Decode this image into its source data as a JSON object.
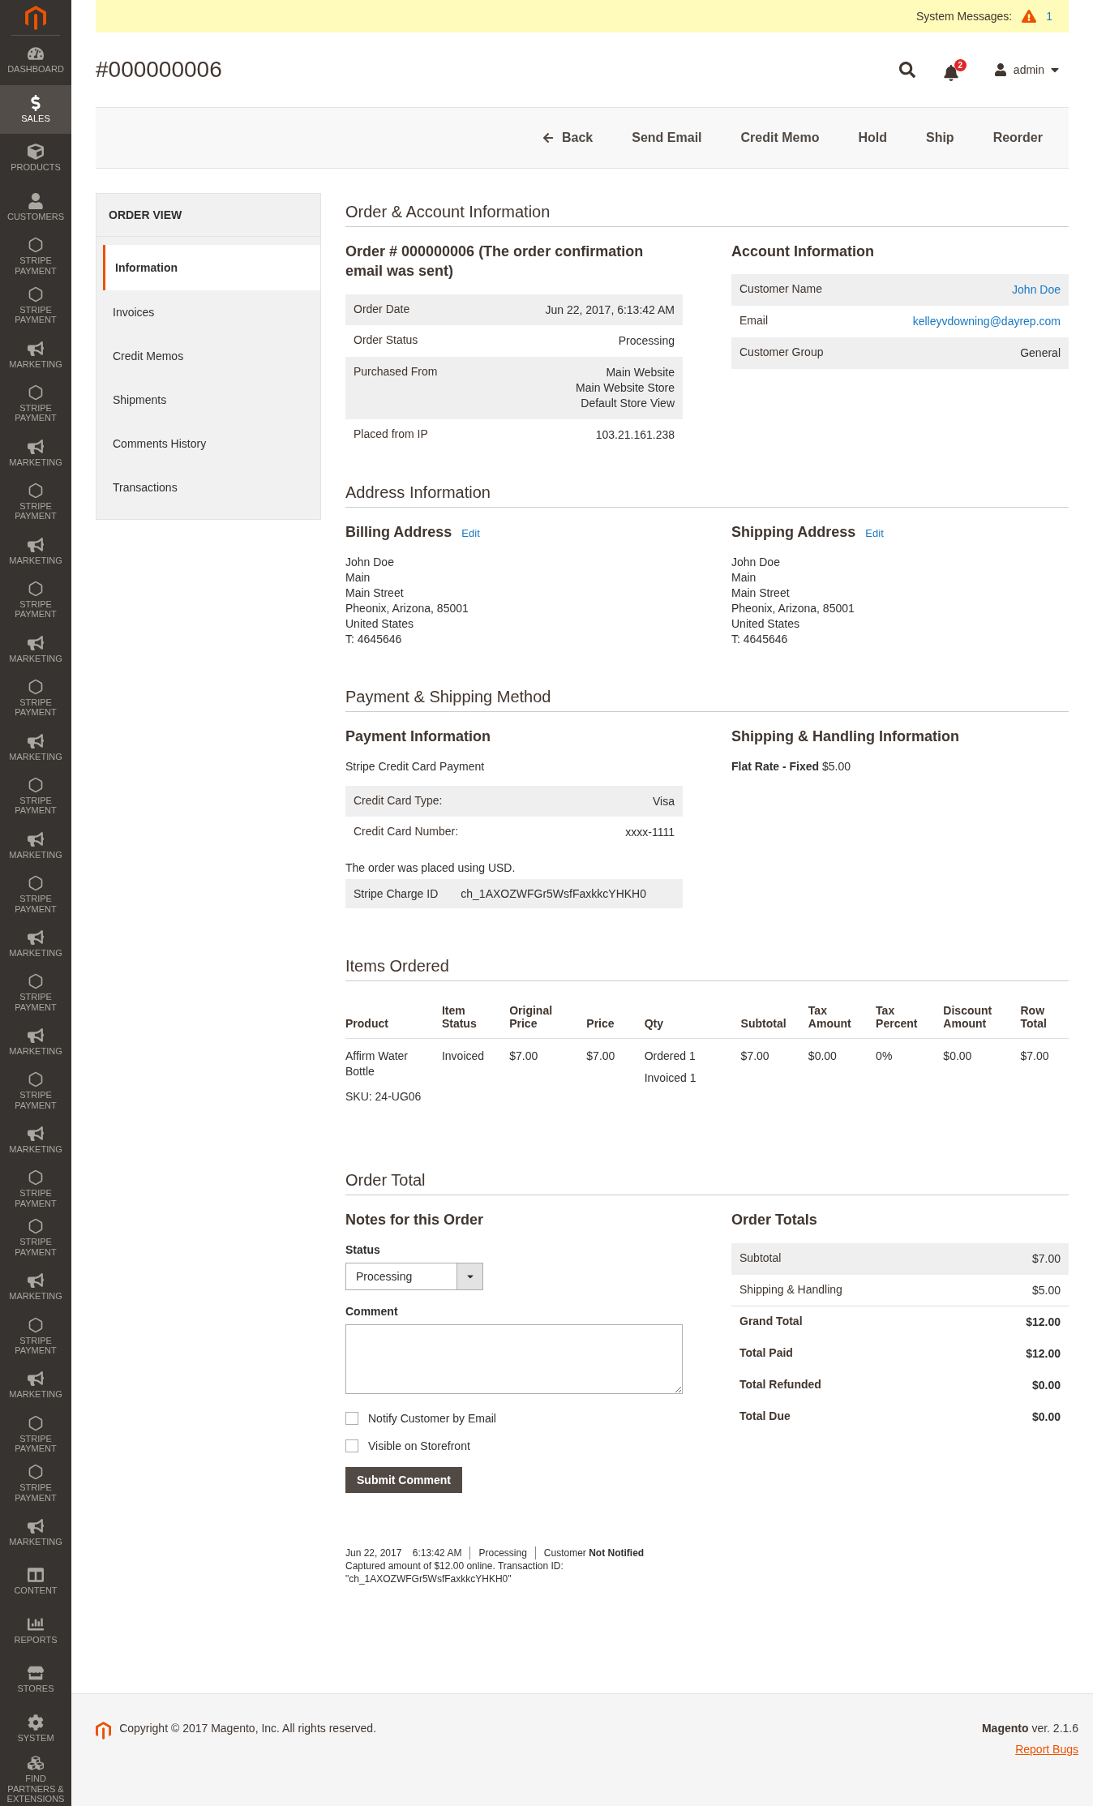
{
  "sidebar": {
    "items": [
      {
        "kind": "dashboard",
        "label": "DASHBOARD",
        "selected": false
      },
      {
        "kind": "sales",
        "label": "SALES",
        "selected": true
      },
      {
        "kind": "products",
        "label": "PRODUCTS",
        "selected": false
      },
      {
        "kind": "customers",
        "label": "CUSTOMERS",
        "selected": false
      },
      {
        "kind": "stripe",
        "label": "STRIPE PAYMENT",
        "selected": false
      },
      {
        "kind": "stripe",
        "label": "STRIPE PAYMENT",
        "selected": false
      },
      {
        "kind": "marketing",
        "label": "MARKETING",
        "selected": false
      },
      {
        "kind": "stripe",
        "label": "STRIPE PAYMENT",
        "selected": false
      },
      {
        "kind": "marketing",
        "label": "MARKETING",
        "selected": false
      },
      {
        "kind": "stripe",
        "label": "STRIPE PAYMENT",
        "selected": false
      },
      {
        "kind": "marketing",
        "label": "MARKETING",
        "selected": false
      },
      {
        "kind": "stripe",
        "label": "STRIPE PAYMENT",
        "selected": false
      },
      {
        "kind": "marketing",
        "label": "MARKETING",
        "selected": false
      },
      {
        "kind": "stripe",
        "label": "STRIPE PAYMENT",
        "selected": false
      },
      {
        "kind": "marketing",
        "label": "MARKETING",
        "selected": false
      },
      {
        "kind": "stripe",
        "label": "STRIPE PAYMENT",
        "selected": false
      },
      {
        "kind": "marketing",
        "label": "MARKETING",
        "selected": false
      },
      {
        "kind": "stripe",
        "label": "STRIPE PAYMENT",
        "selected": false
      },
      {
        "kind": "marketing",
        "label": "MARKETING",
        "selected": false
      },
      {
        "kind": "stripe",
        "label": "STRIPE PAYMENT",
        "selected": false
      },
      {
        "kind": "marketing",
        "label": "MARKETING",
        "selected": false
      },
      {
        "kind": "stripe",
        "label": "STRIPE PAYMENT",
        "selected": false
      },
      {
        "kind": "marketing",
        "label": "MARKETING",
        "selected": false
      },
      {
        "kind": "stripe",
        "label": "STRIPE PAYMENT",
        "selected": false
      },
      {
        "kind": "stripe",
        "label": "STRIPE PAYMENT",
        "selected": false
      },
      {
        "kind": "marketing",
        "label": "MARKETING",
        "selected": false
      },
      {
        "kind": "stripe",
        "label": "STRIPE PAYMENT",
        "selected": false
      },
      {
        "kind": "marketing",
        "label": "MARKETING",
        "selected": false
      },
      {
        "kind": "stripe",
        "label": "STRIPE PAYMENT",
        "selected": false
      },
      {
        "kind": "stripe",
        "label": "STRIPE PAYMENT",
        "selected": false
      },
      {
        "kind": "marketing",
        "label": "MARKETING",
        "selected": false
      },
      {
        "kind": "content",
        "label": "CONTENT",
        "selected": false
      },
      {
        "kind": "reports",
        "label": "REPORTS",
        "selected": false
      },
      {
        "kind": "stores",
        "label": "STORES",
        "selected": false
      },
      {
        "kind": "system",
        "label": "SYSTEM",
        "selected": false
      },
      {
        "kind": "partners",
        "label": "FIND PARTNERS & EXTENSIONS",
        "selected": false
      }
    ]
  },
  "system_messages": {
    "label": "System Messages:",
    "count": "1"
  },
  "header": {
    "title": "#000000006",
    "notifications": "2",
    "user": "admin"
  },
  "actions": [
    {
      "kind": "back",
      "label": "Back"
    },
    {
      "kind": "plain",
      "label": "Send Email"
    },
    {
      "kind": "plain",
      "label": "Credit Memo"
    },
    {
      "kind": "plain",
      "label": "Hold"
    },
    {
      "kind": "plain",
      "label": "Ship"
    },
    {
      "kind": "plain",
      "label": "Reorder"
    }
  ],
  "order_view": {
    "title": "ORDER VIEW",
    "tabs": [
      {
        "label": "Information",
        "selected": true
      },
      {
        "label": "Invoices",
        "selected": false
      },
      {
        "label": "Credit Memos",
        "selected": false
      },
      {
        "label": "Shipments",
        "selected": false
      },
      {
        "label": "Comments History",
        "selected": false
      },
      {
        "label": "Transactions",
        "selected": false
      }
    ]
  },
  "order_account": {
    "title": "Order & Account Information",
    "order": {
      "heading": "Order # 000000006 (The order confirmation email was sent)",
      "rows": [
        {
          "label": "Order Date",
          "value": [
            "Jun 22, 2017, 6:13:42 AM"
          ]
        },
        {
          "label": "Order Status",
          "value": [
            "Processing"
          ]
        },
        {
          "label": "Purchased From",
          "value": [
            "Main Website",
            "Main Website Store",
            "Default Store View"
          ]
        },
        {
          "label": "Placed from IP",
          "value": [
            "103.21.161.238"
          ]
        }
      ]
    },
    "account": {
      "heading": "Account Information",
      "rows": [
        {
          "label": "Customer Name",
          "value": "John Doe",
          "kind": "link"
        },
        {
          "label": "Email",
          "value": "kelleyvdowning@dayrep.com",
          "kind": "link"
        },
        {
          "label": "Customer Group",
          "value": "General",
          "kind": "plain"
        }
      ]
    }
  },
  "address": {
    "title": "Address Information",
    "billing": {
      "heading": "Billing Address",
      "edit": "Edit",
      "lines": [
        "John Doe",
        "Main",
        "Main Street",
        "Pheonix, Arizona, 85001",
        "United States",
        "T: 4645646"
      ]
    },
    "shipping": {
      "heading": "Shipping Address",
      "edit": "Edit",
      "lines": [
        "John Doe",
        "Main",
        "Main Street",
        "Pheonix, Arizona, 85001",
        "United States",
        "T: 4645646"
      ]
    }
  },
  "payment": {
    "title": "Payment & Shipping Method",
    "payment_info": {
      "heading": "Payment Information",
      "method": "Stripe Credit Card Payment",
      "rows": [
        {
          "label": "Credit Card Type:",
          "value": "Visa"
        },
        {
          "label": "Credit Card Number:",
          "value": "xxxx-1111"
        }
      ],
      "currency_note": "The order was placed using USD.",
      "charge": {
        "label": "Stripe Charge ID",
        "value": "ch_1AXOZWFGr5WsfFaxkkcYHKH0"
      }
    },
    "shipping_info": {
      "heading": "Shipping & Handling Information",
      "method": "**Flat Rate - Fixed** $5.00"
    }
  },
  "items": {
    "title": "Items Ordered",
    "columns": [
      "Product",
      "Item Status",
      "Original Price",
      "Price",
      "Qty",
      "Subtotal",
      "Tax Amount",
      "Tax Percent",
      "Discount Amount",
      "Row Total"
    ],
    "rows": [
      {
        "product": "Affirm Water Bottle",
        "sku": "SKU: 24-UG06",
        "status": "Invoiced",
        "original_price": "$7.00",
        "price": "$7.00",
        "qty": [
          {
            "label": "Ordered",
            "value": "1"
          },
          {
            "label": "Invoiced",
            "value": "1"
          }
        ],
        "subtotal": "$7.00",
        "tax_amount": "$0.00",
        "tax_percent": "0%",
        "discount": "$0.00",
        "row_total": "$7.00"
      }
    ]
  },
  "order_total": {
    "title": "Order Total",
    "notes": {
      "heading": "Notes for this Order",
      "status_label": "Status",
      "status_value": "Processing",
      "comment_label": "Comment",
      "checkboxes": [
        {
          "label": "Notify Customer by Email",
          "checked": false
        },
        {
          "label": "Visible on Storefront",
          "checked": false
        }
      ],
      "submit": "Submit Comment"
    },
    "totals": {
      "heading": "Order Totals",
      "rows": [
        {
          "label": "Subtotal",
          "value": "$7.00",
          "kind": "shaded"
        },
        {
          "label": "Shipping & Handling",
          "value": "$5.00",
          "kind": "plain"
        },
        {
          "label": "Grand Total",
          "value": "$12.00",
          "kind": "strong"
        },
        {
          "label": "Total Paid",
          "value": "$12.00",
          "kind": "strong"
        },
        {
          "label": "Total Refunded",
          "value": "$0.00",
          "kind": "strong"
        },
        {
          "label": "Total Due",
          "value": "$0.00",
          "kind": "strong"
        }
      ]
    }
  },
  "history": [
    {
      "date": "Jun 22, 2017",
      "time": "6:13:42 AM",
      "status": "Processing",
      "notified": "Customer **Not Notified**",
      "note": "Captured amount of $12.00 online. Transaction ID: \"ch_1AXOZWFGr5WsfFaxkkcYHKH0\""
    }
  ],
  "footer": {
    "copyright": "Copyright © 2017 Magento, Inc. All rights reserved.",
    "version": "**Magento** ver. 2.1.6",
    "report": "Report Bugs"
  }
}
